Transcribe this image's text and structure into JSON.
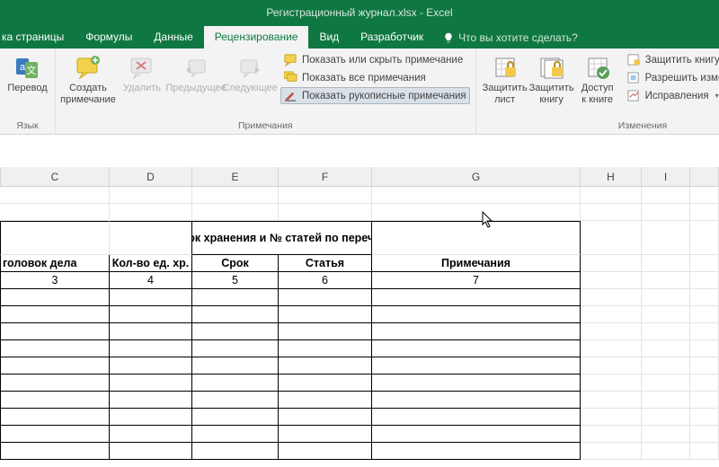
{
  "title": {
    "file": "Регистрационный журнал.xlsx",
    "app": "Excel"
  },
  "tabs": {
    "layout_truncated": "ка страницы",
    "formulas": "Формулы",
    "data": "Данные",
    "review": "Рецензирование",
    "view": "Вид",
    "developer": "Разработчик",
    "tellme": "Что вы хотите сделать?"
  },
  "ribbon": {
    "language": {
      "translate": "Перевод",
      "group": "Язык"
    },
    "comments": {
      "new": "Создать\nпримечание",
      "delete": "Удалить",
      "previous": "Предыдущее",
      "next": "Следующее",
      "show_hide": "Показать или скрыть примечание",
      "show_all": "Показать все примечания",
      "show_ink": "Показать рукописные примечания",
      "group": "Примечания"
    },
    "protect": {
      "sheet": "Защитить\nлист",
      "workbook": "Защитить\nкнигу",
      "share": "Доступ\nк книге"
    },
    "changes": {
      "protect_share": "Защитить книгу и дать общий д",
      "allow_ranges": "Разрешить изменение диапазон",
      "track": "Исправления",
      "group": "Изменения"
    }
  },
  "columns": {
    "c": "C",
    "d": "D",
    "e": "E",
    "f": "F",
    "g": "G",
    "h": "H",
    "i": "I"
  },
  "table": {
    "merged_header": "Срок хранения и № статей по перечню",
    "h1": "головок дела",
    "h2": "Кол-во ед. хр.",
    "h3": "Срок",
    "h4": "Статья",
    "h5": "Примечания",
    "n3": "3",
    "n4": "4",
    "n5": "5",
    "n6": "6",
    "n7": "7"
  },
  "chart_data": {
    "type": "table",
    "headers_row1": [
      "головок дела",
      "Кол-во ед. хр.",
      "Срок хранения и № статей по перечню",
      "",
      "Примечания"
    ],
    "headers_row2": [
      "",
      "",
      "Срок",
      "Статья",
      ""
    ],
    "column_numbers": [
      3,
      4,
      5,
      6,
      7
    ],
    "data_rows": [
      [
        "",
        "",
        "",
        "",
        ""
      ],
      [
        "",
        "",
        "",
        "",
        ""
      ],
      [
        "",
        "",
        "",
        "",
        ""
      ],
      [
        "",
        "",
        "",
        "",
        ""
      ],
      [
        "",
        "",
        "",
        "",
        ""
      ],
      [
        "",
        "",
        "",
        "",
        ""
      ],
      [
        "",
        "",
        "",
        "",
        ""
      ],
      [
        "",
        "",
        "",
        "",
        ""
      ],
      [
        "",
        "",
        "",
        "",
        ""
      ],
      [
        "",
        "",
        "",
        "",
        ""
      ]
    ]
  }
}
